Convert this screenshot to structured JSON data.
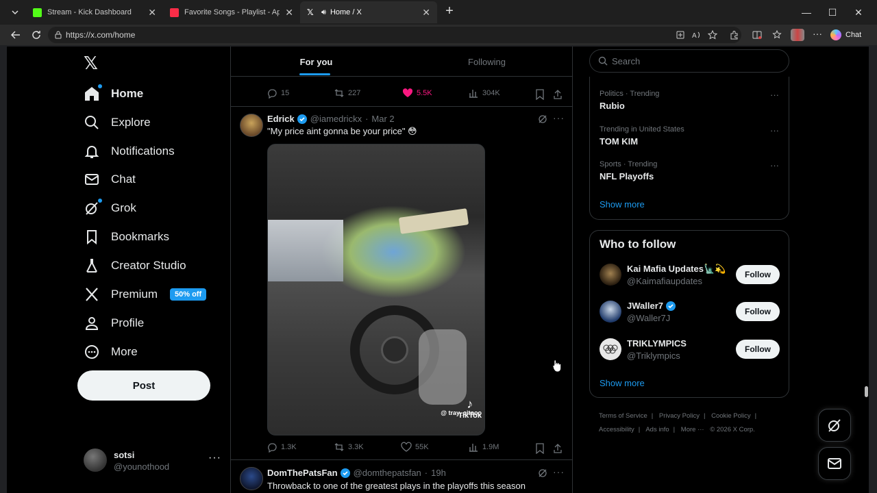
{
  "browser": {
    "tabs": [
      {
        "title": "Stream - Kick Dashboard",
        "favicon_color": "#53fc18"
      },
      {
        "title": "Favorite Songs - Playlist - Apple Music",
        "favicon_color": "#fa2d48"
      },
      {
        "title": "Home / X",
        "favicon_color": "#ffffff"
      }
    ],
    "url": "https://x.com/home",
    "chat_label": "Chat"
  },
  "nav": {
    "items": [
      {
        "label": "Home",
        "icon": "home-icon"
      },
      {
        "label": "Explore",
        "icon": "search-icon"
      },
      {
        "label": "Notifications",
        "icon": "bell-icon"
      },
      {
        "label": "Chat",
        "icon": "mail-icon"
      },
      {
        "label": "Grok",
        "icon": "grok-icon"
      },
      {
        "label": "Bookmarks",
        "icon": "bookmark-icon"
      },
      {
        "label": "Creator Studio",
        "icon": "flask-icon"
      },
      {
        "label": "Premium",
        "icon": "x-logo-icon"
      },
      {
        "label": "Profile",
        "icon": "person-icon"
      },
      {
        "label": "More",
        "icon": "more-circle-icon"
      }
    ],
    "premium_badge": "50% off",
    "post_label": "Post",
    "account": {
      "name": "sotsi",
      "handle": "@younothood"
    }
  },
  "feed": {
    "tabs": [
      "For you",
      "Following"
    ],
    "prev_tweet_stats": {
      "replies": "15",
      "reposts": "227",
      "likes": "5.5K",
      "views": "304K"
    },
    "tweet": {
      "name": "Edrick",
      "handle": "@iamedrickx",
      "date": "Mar 2",
      "text": "\"My price aint gonna be your price\" 😳",
      "watermark": "TikTok",
      "watermark_handle": "@ tray_citooo",
      "stats": {
        "replies": "1.3K",
        "reposts": "3.3K",
        "likes": "55K",
        "views": "1.9M"
      }
    },
    "next_tweet": {
      "name": "DomThePatsFan",
      "handle": "@domthepatsfan",
      "date": "19h",
      "text": "Throwback to one of the greatest plays in the playoffs this season"
    }
  },
  "sidebar": {
    "search_placeholder": "Search",
    "trends": [
      {
        "category": "Politics · Trending",
        "name": "Rubio"
      },
      {
        "category": "Trending in United States",
        "name": "TOM KIM"
      },
      {
        "category": "Sports · Trending",
        "name": "NFL Playoffs"
      }
    ],
    "show_more": "Show more",
    "who_to_follow_title": "Who to follow",
    "who_to_follow": [
      {
        "name": "Kai Mafia Updates🗽💫",
        "handle": "@Kaimafiaupdates",
        "verified": false
      },
      {
        "name": "JWaller7",
        "handle": "@Waller7J",
        "verified": true
      },
      {
        "name": "TRIKLYMPICS",
        "handle": "@Triklympics",
        "verified": false
      }
    ],
    "follow_label": "Follow",
    "footer": [
      "Terms of Service",
      "Privacy Policy",
      "Cookie Policy",
      "Accessibility",
      "Ads info",
      "More ···",
      "© 2026 X Corp."
    ]
  },
  "colors": {
    "accent": "#1d9bf0",
    "like": "#f91880",
    "background": "#000000"
  }
}
